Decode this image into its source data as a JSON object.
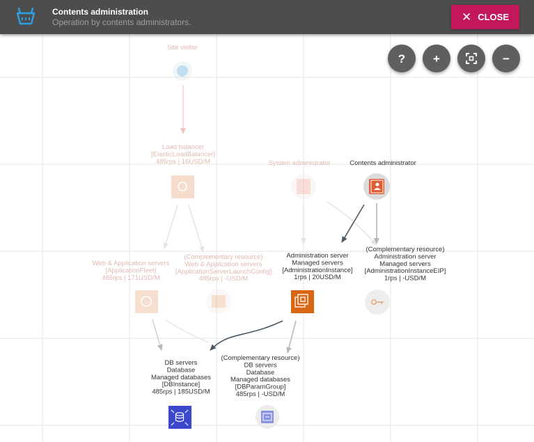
{
  "header": {
    "title": "Contents administration",
    "subtitle": "Operation by contents administrators.",
    "close_label": "CLOSE"
  },
  "toolbar": {
    "help_label": "?",
    "zoom_in_label": "+",
    "zoom_out_label": "−"
  },
  "nodes": {
    "site_visitor": {
      "lines": [
        "Site visitor"
      ]
    },
    "load_balancer": {
      "lines": [
        "Load balancer",
        "[ElasticLoadBalancer]",
        "485rps | 16USD/M"
      ]
    },
    "system_admin": {
      "lines": [
        "System administrator"
      ]
    },
    "contents_admin": {
      "lines": [
        "Contents administrator"
      ]
    },
    "web_servers": {
      "lines": [
        "Web & Application servers",
        "[ApplicationFleet]",
        "485rps | 171USD/M"
      ]
    },
    "web_servers_config": {
      "lines": [
        "(Complementary resource)",
        "Web & Application servers",
        "[ApplicationServerLaunchConfig]",
        "485rps | -USD/M"
      ]
    },
    "admin_server": {
      "lines": [
        "Administration server",
        "Managed servers",
        "[AdministrationInstance]",
        "1rps | 20USD/M"
      ]
    },
    "admin_server_eip": {
      "lines": [
        "(Complementary resource)",
        "Administration server",
        "Managed servers",
        "[AdministrationInstanceEIP]",
        "1rps | -USD/M"
      ]
    },
    "db_servers": {
      "lines": [
        "DB servers",
        "Database",
        "Managed databases",
        "[DBInstance]",
        "485rps | 185USD/M"
      ]
    },
    "db_param_group": {
      "lines": [
        "(Complementary resource)",
        "DB servers",
        "Database",
        "Managed databases",
        "[DBParamGroup]",
        "485rps | -USD/M"
      ]
    }
  },
  "colors": {
    "header_bg": "#4d4d4d",
    "close_button": "#c2185b",
    "compute_orange": "#d86613",
    "database_blue": "#3b48cc",
    "user_orange": "#e05e36",
    "edge_active": "#4a5a66",
    "edge_muted": "#b8b8b8"
  }
}
